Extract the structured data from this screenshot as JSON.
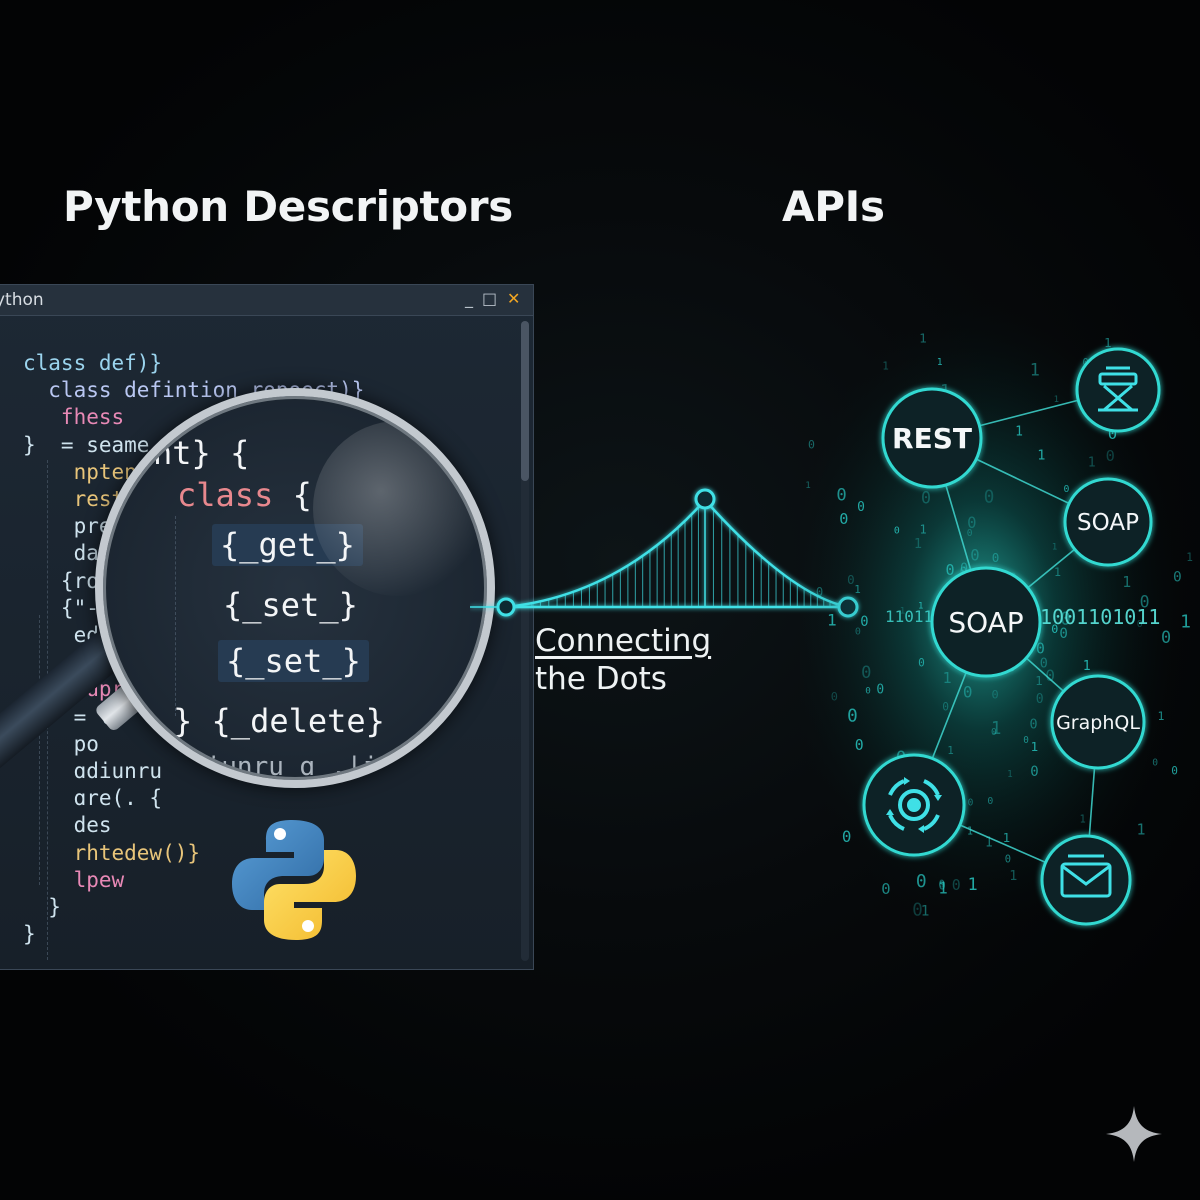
{
  "titles": {
    "left": "Python Descriptors",
    "right": "APIs"
  },
  "editor": {
    "window_title": "ython",
    "buttons": {
      "minimize": "_",
      "maximize": "□",
      "close": "✕"
    },
    "code_lines": [
      "class def)}",
      "  class defintion ropoect)}",
      "   fhess",
      "}  = seame",
      "    nptenv",
      "    rest",
      "    pre",
      "    dat",
      "   {ro",
      "   {\"-",
      "    ede",
      "    des",
      "    ɑupr",
      "    = l",
      "    po",
      "    ɑdiunru",
      "    ɑre(. {",
      "    des",
      "    rhtedew()}",
      "    lpew",
      "  }",
      "}"
    ],
    "code_colors": [
      "#9bd4ee",
      "#b9c7f2",
      "#e889b6",
      "#cfe3ee",
      "#e8c57a",
      "#e8c57a",
      "#cfe3ee",
      "#cfe3ee",
      "#cfe3ee",
      "#cfe3ee",
      "#cfe3ee",
      "#cfe3ee",
      "#e889b6",
      "#cfe3ee",
      "#cfe3ee",
      "#cfe3ee",
      "#cfe3ee",
      "#cfe3ee",
      "#e8c57a",
      "#e889b6",
      "#cfe3ee",
      "#cfe3ee"
    ]
  },
  "magnifier": {
    "line1": "nt} {",
    "line2_keyword": "class",
    "line2_rest": " {",
    "line3": "{_get_}",
    "line4": "{_set_}",
    "line5": "{_set_}",
    "line6": "} {_delete}",
    "line7": "  ɑdiunru ɑ_.|ject ,"
  },
  "python_logo": "python-logo",
  "bridge": {
    "label_line1": "Connecting",
    "label_line2": "the Dots",
    "accent": "#3fe0e6"
  },
  "network": {
    "nodes": {
      "rest": "REST",
      "soap_small": "SOAP",
      "soap_center": "SOAP",
      "graphql": "GraphQL"
    },
    "binary_left": "1101110",
    "binary_right": "1001101011",
    "icons": [
      "robot-icon",
      "gears-icon",
      "mail-icon"
    ],
    "accent": "#2ad6d0"
  },
  "watermark": "sparkle-icon",
  "colors": {
    "background": "#050708",
    "editor_bg": "#1b2430",
    "teal": "#2ad6d0",
    "python_blue": "#3a78b8",
    "python_yellow": "#f7cc3f"
  }
}
